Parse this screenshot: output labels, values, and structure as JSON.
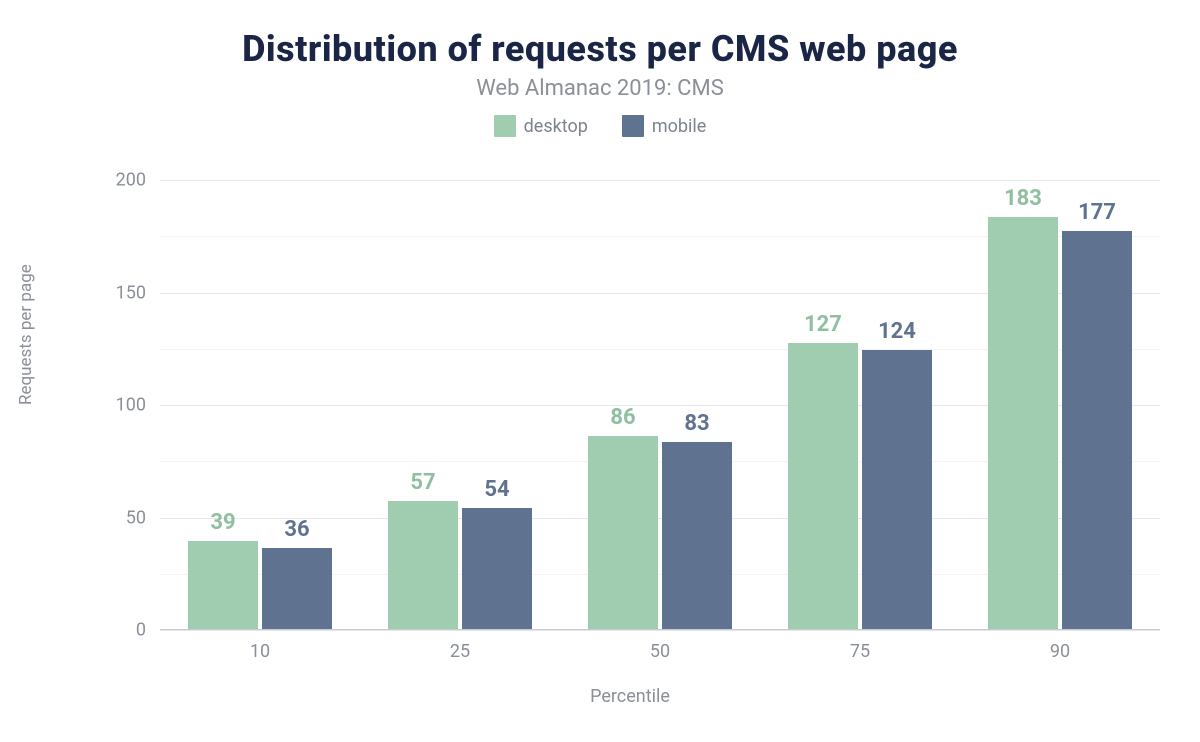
{
  "chart_data": {
    "type": "bar",
    "title": "Distribution of requests per CMS web page",
    "subtitle": "Web Almanac 2019: CMS",
    "xlabel": "Percentile",
    "ylabel": "Requests per page",
    "categories": [
      "10",
      "25",
      "50",
      "75",
      "90"
    ],
    "series": [
      {
        "name": "desktop",
        "values": [
          39,
          57,
          86,
          127,
          183
        ],
        "color": "#a0cdb0",
        "label_color": "#8fbea0"
      },
      {
        "name": "mobile",
        "values": [
          36,
          54,
          83,
          124,
          177
        ],
        "color": "#5f7391",
        "label_color": "#5f7391"
      }
    ],
    "ylim": [
      0,
      200
    ],
    "yticks": [
      0,
      50,
      100,
      150,
      200
    ],
    "grid": true
  }
}
